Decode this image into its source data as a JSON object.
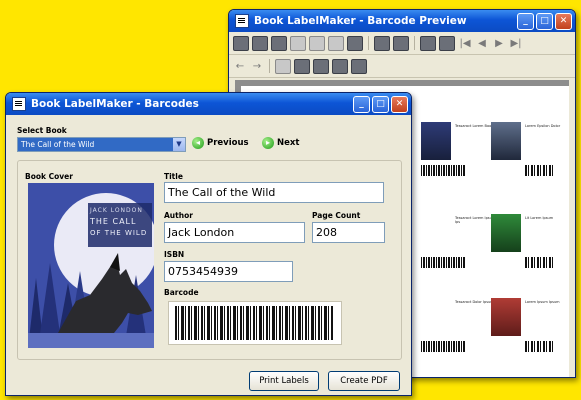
{
  "preview_window": {
    "title": "Book LabelMaker - Barcode Preview",
    "labels": [
      {
        "text": "Tessaract Lorem Book"
      },
      {
        "text": "Lorem Epsilon Dolor"
      },
      {
        "text": "Tessaract Lorem Ipsum Ips"
      },
      {
        "text": "Lit Lorem Ipsum"
      },
      {
        "text": "Tessaract Dolor Ipsum"
      },
      {
        "text": "Lorem Ipsum Ipsum"
      }
    ]
  },
  "main_window": {
    "title": "Book LabelMaker - Barcodes",
    "select_book_label": "Select Book",
    "selected_book": "The Call of the Wild",
    "previous_label": "Previous",
    "next_label": "Next",
    "book_cover_label": "Book Cover",
    "cover": {
      "line1": "JACK LONDON",
      "line2": "THE CALL",
      "line3": "OF THE WILD"
    },
    "title_label": "Title",
    "title_value": "The Call of the Wild",
    "author_label": "Author",
    "author_value": "Jack London",
    "page_count_label": "Page Count",
    "page_count_value": "208",
    "isbn_label": "ISBN",
    "isbn_value": "0753454939",
    "barcode_label": "Barcode",
    "print_labels_label": "Print Labels",
    "create_pdf_label": "Create PDF"
  },
  "icons": [
    "app-icon",
    "minimize-icon",
    "maximize-icon",
    "close-icon",
    "previous-icon",
    "next-icon",
    "dropdown-arrow-icon"
  ],
  "colors": {
    "background": "#ffe600",
    "titlebar": "#0d55d6",
    "nav_green": "#1c9a17"
  }
}
